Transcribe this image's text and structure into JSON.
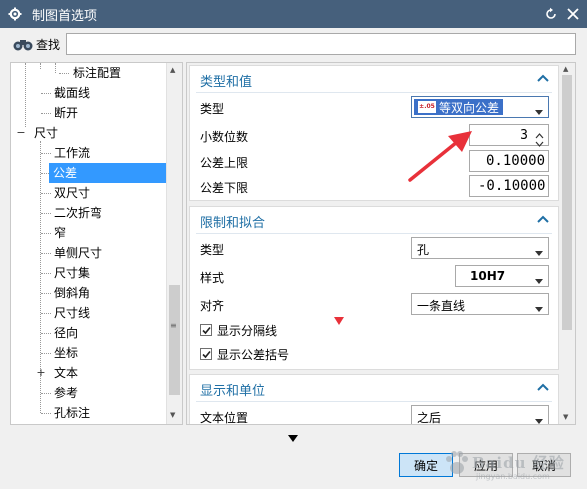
{
  "window": {
    "title": "制图首选项"
  },
  "search": {
    "label": "查找",
    "value": ""
  },
  "tree": {
    "items": [
      {
        "label": "标注配置",
        "level": 3,
        "selected": false
      },
      {
        "label": "截面线",
        "level": 2,
        "selected": false
      },
      {
        "label": "断开",
        "level": 2,
        "selected": false
      },
      {
        "label": "尺寸",
        "level": 1,
        "selected": false,
        "expander": "−"
      },
      {
        "label": "工作流",
        "level": 2,
        "selected": false
      },
      {
        "label": "公差",
        "level": 2,
        "selected": true
      },
      {
        "label": "双尺寸",
        "level": 2,
        "selected": false
      },
      {
        "label": "二次折弯",
        "level": 2,
        "selected": false
      },
      {
        "label": "窄",
        "level": 2,
        "selected": false
      },
      {
        "label": "单侧尺寸",
        "level": 2,
        "selected": false
      },
      {
        "label": "尺寸集",
        "level": 2,
        "selected": false
      },
      {
        "label": "倒斜角",
        "level": 2,
        "selected": false
      },
      {
        "label": "尺寸线",
        "level": 2,
        "selected": false
      },
      {
        "label": "径向",
        "level": 2,
        "selected": false
      },
      {
        "label": "坐标",
        "level": 2,
        "selected": false
      },
      {
        "label": "文本",
        "level": 2,
        "selected": false,
        "expander": "+"
      },
      {
        "label": "参考",
        "level": 2,
        "selected": false
      },
      {
        "label": "孔标注",
        "level": 2,
        "selected": false
      }
    ]
  },
  "type_value": {
    "title": "类型和值",
    "type_label": "类型",
    "type_value": "等双向公差",
    "type_icon_text": "±.05",
    "decimals_label": "小数位数",
    "decimals_value": "3",
    "upper_label": "公差上限",
    "upper_value": "0.10000",
    "lower_label": "公差下限",
    "lower_value": "-0.10000"
  },
  "limits_fits": {
    "title": "限制和拟合",
    "type_label": "类型",
    "type_value": "孔",
    "style_label": "样式",
    "style_value": "10H7",
    "align_label": "对齐",
    "align_value": "一条直线",
    "show_separator_label": "显示分隔线",
    "show_separator_checked": true,
    "show_brackets_label": "显示公差括号",
    "show_brackets_checked": true
  },
  "display_units": {
    "title": "显示和单位",
    "text_pos_label": "文本位置",
    "text_pos_value": "之后"
  },
  "buttons": {
    "ok": "确定",
    "apply": "应用",
    "cancel": "取消"
  },
  "watermark": {
    "text": "Baidu 经验",
    "sub": "jingyan.baidu.com"
  },
  "colors": {
    "titlebar": "#46607c",
    "accent": "#1f6fa5",
    "selection": "#3399ff",
    "annotation": "#e8313a"
  }
}
